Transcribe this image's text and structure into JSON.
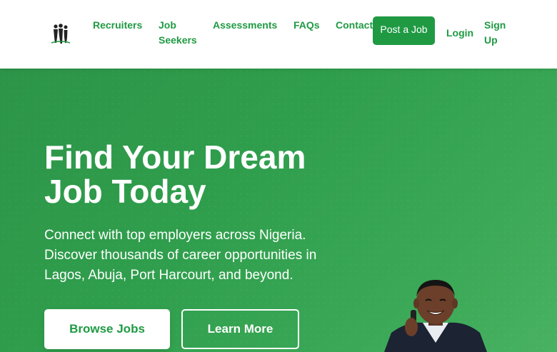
{
  "brand": {
    "logo_icon": "group-of-people-icon",
    "accent_color": "#1f9a43"
  },
  "nav": {
    "links": [
      {
        "label": "Recruiters"
      },
      {
        "label": "Job Seekers"
      },
      {
        "label": "Assessments"
      },
      {
        "label": "FAQs"
      },
      {
        "label": "Contact"
      }
    ],
    "post_job_label": "Post a Job",
    "login_label": "Login",
    "signup_label": "Sign Up"
  },
  "hero": {
    "title": "Find Your Dream Job Today",
    "subtitle": "Connect with top employers across Nigeria. Discover thousands of career opportunities in Lagos, Abuja, Port Harcourt, and beyond.",
    "primary_button": "Browse Jobs",
    "secondary_button": "Learn More",
    "background_color": "#2f9e4c"
  }
}
